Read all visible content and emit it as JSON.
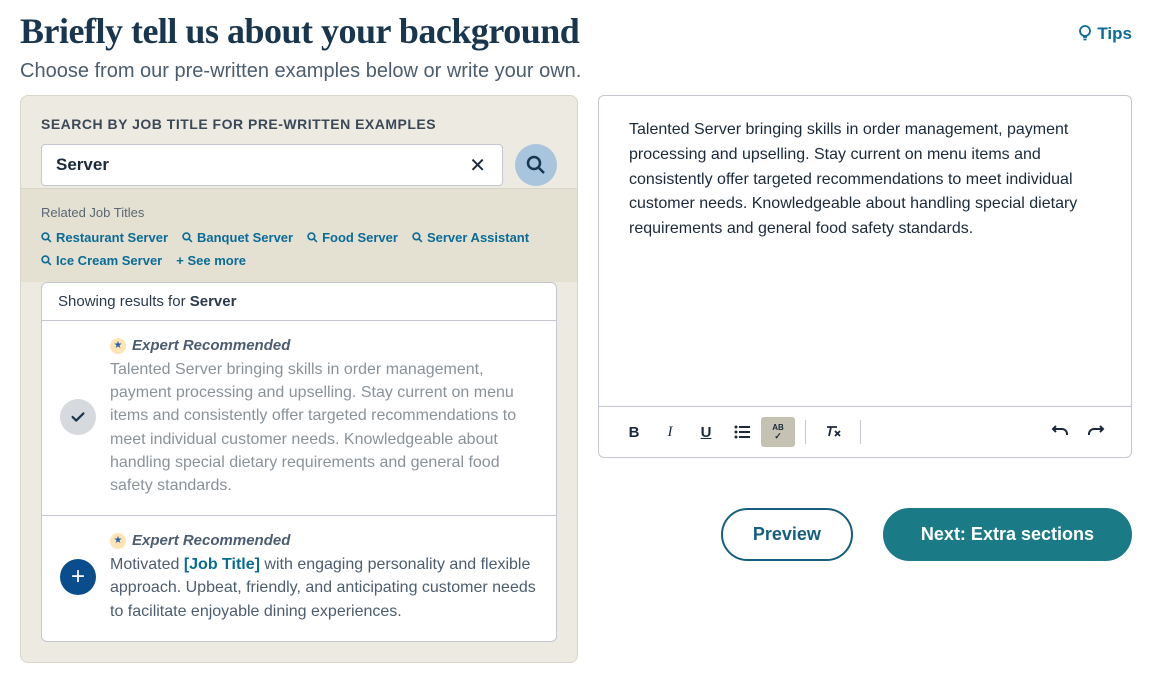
{
  "header": {
    "title": "Briefly tell us about your background",
    "subtitle": "Choose from our pre-written examples below or write your own.",
    "tips_label": "Tips"
  },
  "search": {
    "label": "SEARCH BY JOB TITLE FOR PRE-WRITTEN EXAMPLES",
    "value": "Server",
    "related_label": "Related Job Titles",
    "related_tags": [
      "Restaurant Server",
      "Banquet Server",
      "Food Server",
      "Server Assistant",
      "Ice Cream Server"
    ],
    "see_more": "+ See more"
  },
  "results": {
    "showing_prefix": "Showing results for ",
    "showing_term": "Server",
    "expert_badge": "Expert Recommended",
    "items": [
      {
        "selected": true,
        "text": "Talented Server bringing skills in order management, payment processing and upselling. Stay current on menu items and consistently offer targeted recommendations to meet individual customer needs. Knowledgeable about handling special dietary requirements and general food safety standards."
      },
      {
        "selected": false,
        "prefix": "Motivated ",
        "job_title_placeholder": "[Job Title]",
        "suffix": " with engaging personality and flexible approach. Upbeat, friendly, and anticipating customer needs to facilitate enjoyable dining experiences."
      }
    ]
  },
  "editor": {
    "content": "Talented Server bringing skills in order management, payment processing and upselling. Stay current on menu items and consistently offer targeted recommendations to meet individual customer needs. Knowledgeable about handling special dietary requirements and general food safety standards."
  },
  "toolbar": {
    "bold": "B",
    "italic": "I",
    "underline": "U",
    "spellcheck_top": "AB",
    "spellcheck_bottom": "✓"
  },
  "actions": {
    "preview": "Preview",
    "next": "Next: Extra sections"
  }
}
